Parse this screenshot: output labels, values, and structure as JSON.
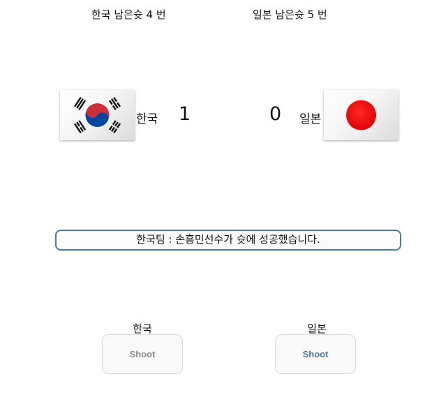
{
  "scoreboard": {
    "korea": {
      "shots_left_text": "한국 남은슛 4 번",
      "name": "한국",
      "score": "1",
      "flag_icon": "korea-flag-icon"
    },
    "japan": {
      "shots_left_text": "일본 남은슛 5 번",
      "name": "일본",
      "score": "0",
      "flag_icon": "japan-flag-icon"
    }
  },
  "message": "한국팀 : 손흥민선수가 슛에 성공했습니다.",
  "controls": {
    "korea": {
      "label": "한국",
      "button": "Shoot",
      "button_color": "#8a8a8a"
    },
    "japan": {
      "label": "일본",
      "button": "Shoot",
      "button_color": "#4a78a8"
    }
  },
  "colors": {
    "message_border": "#4a7aa6",
    "korea_red": "#cd2e3a",
    "korea_blue": "#0047a0",
    "japan_red": "#e8000a"
  }
}
